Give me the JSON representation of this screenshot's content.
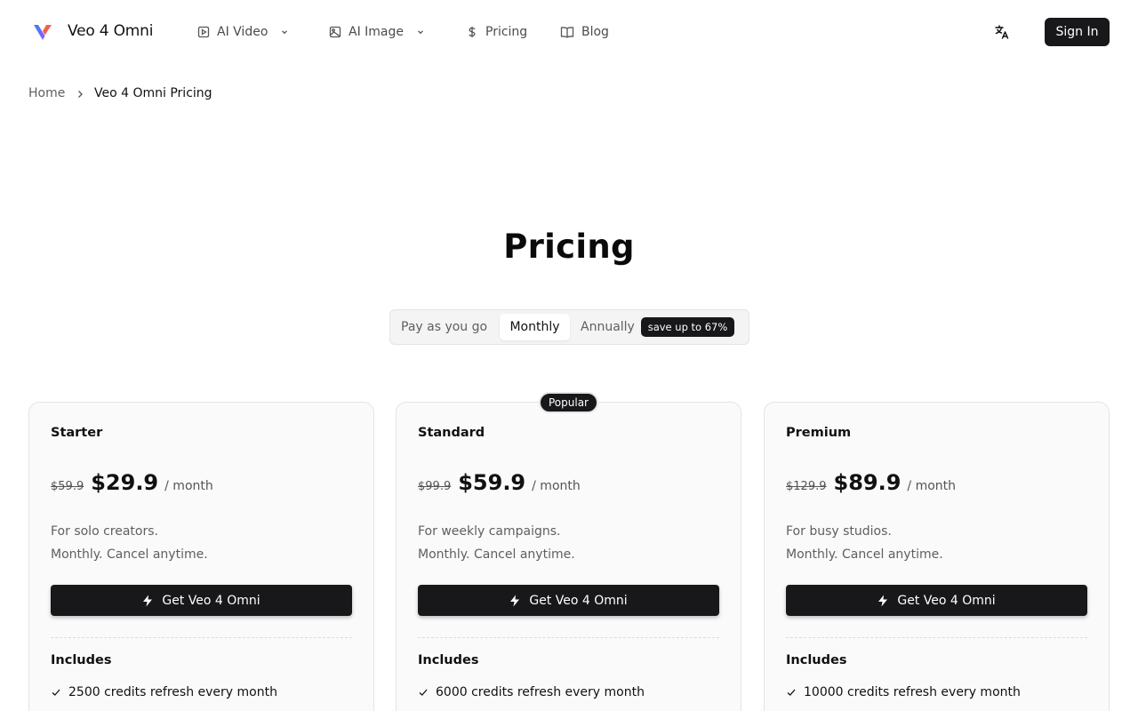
{
  "brand": {
    "name": "Veo 4 Omni"
  },
  "nav": {
    "items": [
      {
        "label": "AI Video",
        "icon": "play-square-icon",
        "has_dropdown": true
      },
      {
        "label": "AI Image",
        "icon": "image-icon",
        "has_dropdown": true
      },
      {
        "label": "Pricing",
        "icon": "dollar-icon",
        "has_dropdown": false
      },
      {
        "label": "Blog",
        "icon": "book-icon",
        "has_dropdown": false
      }
    ],
    "sign_in_label": "Sign In",
    "language_icon": "translate-icon"
  },
  "breadcrumb": {
    "home": "Home",
    "current": "Veo 4 Omni Pricing"
  },
  "page": {
    "title": "Pricing"
  },
  "billing_toggle": {
    "options": [
      "Pay as you go",
      "Monthly",
      "Annually"
    ],
    "selected": "Monthly",
    "save_badge": "save up to 67%"
  },
  "popular_badge": "Popular",
  "plans": [
    {
      "name": "Starter",
      "old_price": "$59.9",
      "price": "$29.9",
      "period": "/ month",
      "desc1": "For solo creators.",
      "desc2": "Monthly. Cancel anytime.",
      "cta": "Get Veo 4 Omni",
      "includes_label": "Includes",
      "features": [
        "2500 credits refresh every month"
      ]
    },
    {
      "name": "Standard",
      "old_price": "$99.9",
      "price": "$59.9",
      "period": "/ month",
      "desc1": "For weekly campaigns.",
      "desc2": "Monthly. Cancel anytime.",
      "cta": "Get Veo 4 Omni",
      "includes_label": "Includes",
      "features": [
        "6000 credits refresh every month"
      ]
    },
    {
      "name": "Premium",
      "old_price": "$129.9",
      "price": "$89.9",
      "period": "/ month",
      "desc1": "For busy studios.",
      "desc2": "Monthly. Cancel anytime.",
      "cta": "Get Veo 4 Omni",
      "includes_label": "Includes",
      "features": [
        "10000 credits refresh every month"
      ]
    }
  ],
  "colors": {
    "primary": "#18181b",
    "muted_text": "#5f5f5f",
    "border": "#e4e4e7",
    "card_bg": "#fafafa"
  }
}
